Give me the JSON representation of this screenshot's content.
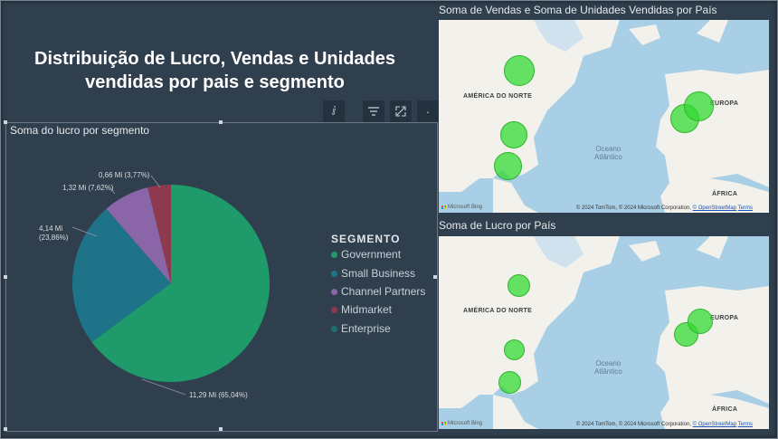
{
  "page": {
    "title_line1": "Distribuição de Lucro, Vendas e Unidades",
    "title_line2": "vendidas por pais e segmento"
  },
  "toolbar": {
    "icons": [
      "info-icon",
      "filter-icon",
      "focus-mode-icon",
      "more-options-icon"
    ]
  },
  "pie": {
    "title": "Soma do lucro por segmento",
    "legend_title": "SEGMENTO",
    "labels": [
      {
        "line1": "11,29 Mi (65,04%)",
        "line2": ""
      },
      {
        "line1": "4,14 Mi",
        "line2": "(23,86%)"
      },
      {
        "line1": "1,32 Mi (7,62%)",
        "line2": ""
      },
      {
        "line1": "0,66 Mi (3,77%)",
        "line2": ""
      }
    ]
  },
  "chart_data": {
    "type": "pie",
    "title": "Soma do lucro por segmento",
    "legend_title": "SEGMENTO",
    "legend_position": "right",
    "categories": [
      "Government",
      "Small Business",
      "Channel Partners",
      "Midmarket",
      "Enterprise"
    ],
    "values": [
      11.29,
      4.14,
      1.32,
      0.66,
      0
    ],
    "percentages": [
      65.04,
      23.86,
      7.62,
      3.77,
      0
    ],
    "unit": "Mi",
    "colors": [
      "#1f9a6b",
      "#1f7388",
      "#8a66a9",
      "#8e3a4e",
      "#1e6f72"
    ]
  },
  "map1": {
    "title": "Soma de Vendas e Soma de Unidades Vendidas por País",
    "labels": {
      "north_america": "AMÉRICA DO NORTE",
      "europe": "EUROPA",
      "africa": "ÁFRICA",
      "ocean": "Oceano",
      "ocean2": "Atlântico"
    },
    "attribution": "© 2024 TomTom, © 2024 Microsoft Corporation,",
    "attribution_link": "© OpenStreetMap",
    "terms": "Terms",
    "logo": "Microsoft Bing"
  },
  "map2": {
    "title": "Soma de Lucro por País",
    "labels": {
      "north_america": "AMÉRICA DO NORTE",
      "europe": "EUROPA",
      "africa": "ÁFRICA",
      "ocean": "Oceano",
      "ocean2": "Atlântico"
    },
    "attribution": "© 2024 TomTom, © 2024 Microsoft Corporation,",
    "attribution_link": "© OpenStreetMap",
    "terms": "Terms",
    "logo": "Microsoft Bing"
  },
  "colors": {
    "background": "#2f3f4e",
    "bubble": "#34d934",
    "ocean": "#a9cfe6",
    "land": "#f3f1ec"
  }
}
